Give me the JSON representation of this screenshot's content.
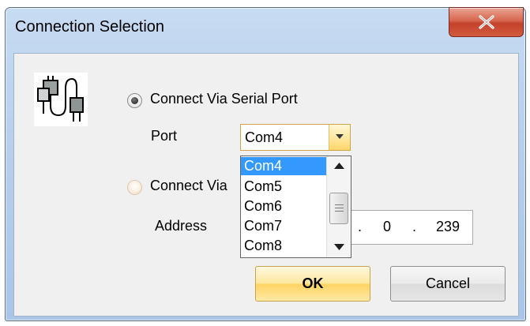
{
  "window": {
    "title": "Connection Selection",
    "close_symbol": "x"
  },
  "icons": {
    "connection": "serial-connection-icon",
    "close": "close-icon",
    "dropdown_arrow": "chevron-down-icon",
    "scroll_up": "scroll-up-arrow-icon",
    "scroll_down": "scroll-down-arrow-icon"
  },
  "serial": {
    "radio_label": "Connect Via Serial Port",
    "selected": true,
    "port_label": "Port",
    "port_value": "Com4"
  },
  "network": {
    "radio_label": "Connect Via",
    "selected": false,
    "address_label": "Address",
    "ip_visible": [
      ".",
      "0",
      ".",
      "239"
    ]
  },
  "dropdown": {
    "options": [
      "Com4",
      "Com5",
      "Com6",
      "Com7",
      "Com8"
    ],
    "selected_index": 0
  },
  "buttons": {
    "ok": "OK",
    "cancel": "Cancel"
  },
  "colors": {
    "selection": "#3399ff",
    "ok_button": "#ffe79f",
    "close_button": "#d15b3f"
  }
}
